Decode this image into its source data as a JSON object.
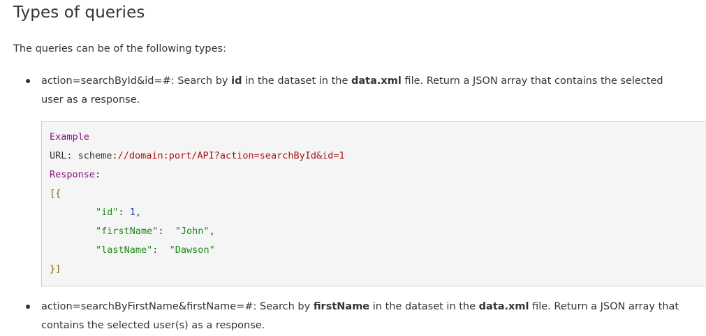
{
  "heading": "Types of queries",
  "intro": "The queries can be of the following types:",
  "items": [
    {
      "code_part": "action=searchById&id=#:",
      "pre": " Search by ",
      "field": "id",
      "mid": " in the dataset in the ",
      "file": "data.xml",
      "post_line1": " file. Return a JSON array that contains the selected",
      "line2": "user as a response."
    },
    {
      "code_part": "action=searchByFirstName&firstName=#:",
      "pre": " Search by ",
      "field": "firstName",
      "mid": " in the dataset in the ",
      "file": "data.xml",
      "post_line1": " file. Return a JSON array that",
      "line2": "contains the selected user(s) as a response."
    }
  ],
  "code": {
    "example_label": "Example",
    "url_label": "URL",
    "colon": ":",
    "url_scheme": "scheme",
    "url_rest": "://domain:port/API?action=searchById&id=1",
    "response_label": "Response",
    "open_bracket": "[{",
    "id_key": "\"id\"",
    "id_value": "1",
    "first_key": "\"firstName\"",
    "first_value": "\"John\"",
    "last_key": "\"lastName\"",
    "last_value": "\"Dawson\"",
    "close_bracket": "}]"
  }
}
